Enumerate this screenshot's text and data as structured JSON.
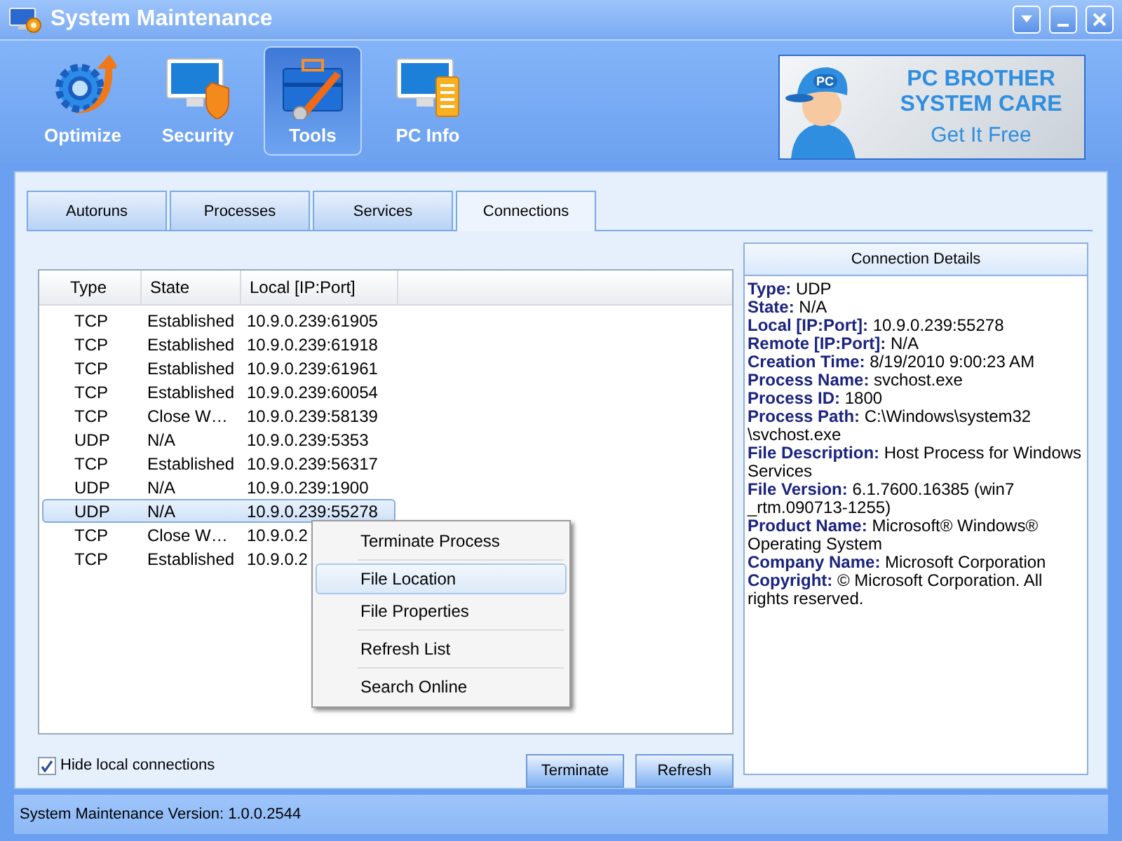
{
  "window": {
    "title": "System Maintenance"
  },
  "toolbar": [
    {
      "label": "Optimize",
      "kind": "optimize",
      "selected": false
    },
    {
      "label": "Security",
      "kind": "security",
      "selected": false
    },
    {
      "label": "Tools",
      "kind": "tools",
      "selected": true
    },
    {
      "label": "PC Info",
      "kind": "info",
      "selected": false
    }
  ],
  "banner": {
    "title_lines": [
      "PC BROTHER",
      "SYSTEM CARE"
    ],
    "action": "Get It Free",
    "badge": "PC"
  },
  "tabs": [
    {
      "label": "Autoruns",
      "selected": false
    },
    {
      "label": "Processes",
      "selected": false
    },
    {
      "label": "Services",
      "selected": false
    },
    {
      "label": "Connections",
      "selected": true
    }
  ],
  "table": {
    "columns": [
      "Type",
      "State",
      "Local [IP:Port]"
    ],
    "rows": [
      {
        "cells": [
          "TCP",
          "Established",
          "10.9.0.239:61905"
        ],
        "selected": false
      },
      {
        "cells": [
          "TCP",
          "Established",
          "10.9.0.239:61918"
        ],
        "selected": false
      },
      {
        "cells": [
          "TCP",
          "Established",
          "10.9.0.239:61961"
        ],
        "selected": false
      },
      {
        "cells": [
          "TCP",
          "Established",
          "10.9.0.239:60054"
        ],
        "selected": false
      },
      {
        "cells": [
          "TCP",
          "Close W…",
          "10.9.0.239:58139"
        ],
        "selected": false
      },
      {
        "cells": [
          "UDP",
          "N/A",
          "10.9.0.239:5353"
        ],
        "selected": false
      },
      {
        "cells": [
          "TCP",
          "Established",
          "10.9.0.239:56317"
        ],
        "selected": false
      },
      {
        "cells": [
          "UDP",
          "N/A",
          "10.9.0.239:1900"
        ],
        "selected": false
      },
      {
        "cells": [
          "UDP",
          "N/A",
          "10.9.0.239:55278"
        ],
        "selected": true
      },
      {
        "cells": [
          "TCP",
          "Close W…",
          "10.9.0.2"
        ],
        "selected": false
      },
      {
        "cells": [
          "TCP",
          "Established",
          "10.9.0.2"
        ],
        "selected": false
      }
    ]
  },
  "context_menu": {
    "items": [
      {
        "label": "Terminate Process",
        "selected": false,
        "separator_after": true
      },
      {
        "label": "File Location",
        "selected": true,
        "separator_after": false
      },
      {
        "label": "File Properties",
        "selected": false,
        "separator_after": true
      },
      {
        "label": "Refresh List",
        "selected": false,
        "separator_after": true
      },
      {
        "label": "Search Online",
        "selected": false,
        "separator_after": false
      }
    ]
  },
  "hide_local": {
    "label": "Hide local connections",
    "checked": true
  },
  "buttons": [
    "Terminate",
    "Refresh"
  ],
  "details": {
    "title": "Connection Details",
    "lines": [
      "**Type:** UDP",
      "**State:** N/A",
      "**Local [IP:Port]:** 10.9.0.239:55278",
      "**Remote [IP:Port]:** N/A",
      "**Creation Time:** 8/19/2010 9:00:23 AM",
      "**Process Name:** svchost.exe",
      "**Process ID:** 1800",
      "**Process Path:** C:\\Windows\\system32 \\svchost.exe",
      "**File Description:** Host Process for Windows Services",
      "**File Version:** 6.1.7600.16385 (win7 _rtm.090713-1255)",
      "**Product Name:** Microsoft® Windows® Operating System",
      "**Company Name:** Microsoft Corporation",
      "**Copyright:** © Microsoft Corporation. All rights reserved."
    ]
  },
  "status_bar": "System Maintenance Version: 1.0.0.2544"
}
